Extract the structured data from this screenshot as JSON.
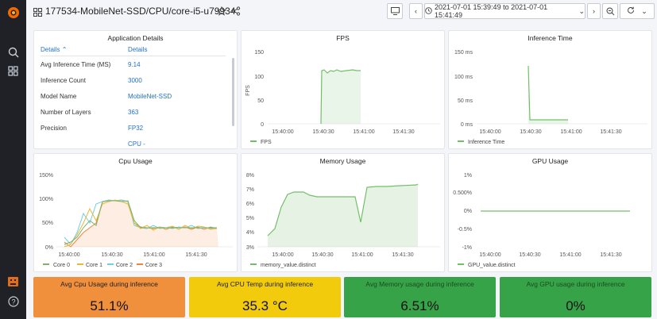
{
  "topbar": {
    "title": "177534-MobileNet-SSD/CPU/core-i5-u79934",
    "time_range": "2021-07-01 15:39:49 to 2021-07-01 15:41:49"
  },
  "app_details": {
    "title": "Application Details",
    "col1_header": "Details",
    "col2_header": "Details",
    "rows": [
      {
        "key": "Avg Inference Time (MS)",
        "value": "9.14"
      },
      {
        "key": "Inference Count",
        "value": "3000"
      },
      {
        "key": "Model Name",
        "value": "MobileNet-SSD"
      },
      {
        "key": "Number of Layers",
        "value": "363"
      },
      {
        "key": "Precision",
        "value": "FP32"
      },
      {
        "key": "",
        "value": "CPU -"
      }
    ]
  },
  "charts": {
    "fps": {
      "title": "FPS",
      "ylabel": "FPS",
      "yticks": [
        "150",
        "100",
        "50",
        "0"
      ],
      "xticks": [
        "15:40:00",
        "15:40:30",
        "15:41:00",
        "15:41:30"
      ],
      "legend": [
        "FPS"
      ]
    },
    "inference": {
      "title": "Inference Time",
      "yticks": [
        "150 ms",
        "100 ms",
        "50 ms",
        "0 ms"
      ],
      "xticks": [
        "15:40:00",
        "15:40:30",
        "15:41:00",
        "15:41:30"
      ],
      "legend": [
        "Inference Time"
      ]
    },
    "cpu": {
      "title": "Cpu Usage",
      "yticks": [
        "150%",
        "100%",
        "50%",
        "0%"
      ],
      "xticks": [
        "15:40:00",
        "15:40:30",
        "15:41:00",
        "15:41:30"
      ],
      "legend": [
        "Core 0",
        "Core 1",
        "Core 2",
        "Core 3"
      ]
    },
    "memory": {
      "title": "Memory Usage",
      "yticks": [
        "8%",
        "7%",
        "6%",
        "5%",
        "4%",
        "3%"
      ],
      "xticks": [
        "15:40:00",
        "15:40:30",
        "15:41:00",
        "15:41:30"
      ],
      "legend": [
        "memory_value.distinct"
      ]
    },
    "gpu": {
      "title": "GPU Usage",
      "yticks": [
        "1%",
        "0.500%",
        "0%",
        "-0.5%",
        "-1%"
      ],
      "xticks": [
        "15:40:00",
        "15:40:30",
        "15:41:00",
        "15:41:30"
      ],
      "legend": [
        "GPU_value.distinct"
      ]
    }
  },
  "chart_data": [
    {
      "type": "line",
      "title": "FPS",
      "ylabel": "FPS",
      "ylim": [
        0,
        150
      ],
      "x": [
        "15:40:28",
        "15:40:29",
        "15:40:31",
        "15:40:35",
        "15:40:40",
        "15:40:45",
        "15:40:50",
        "15:40:56"
      ],
      "series": [
        {
          "name": "FPS",
          "values": [
            0,
            112,
            108,
            110,
            111,
            109,
            111,
            110
          ]
        }
      ]
    },
    {
      "type": "line",
      "title": "Inference Time",
      "ylim": [
        0,
        150
      ],
      "x": [
        "15:40:30",
        "15:40:31",
        "15:40:33",
        "15:40:45",
        "15:40:58"
      ],
      "series": [
        {
          "name": "Inference Time",
          "values": [
            120,
            10,
            9,
            9,
            9
          ]
        }
      ]
    },
    {
      "type": "line",
      "title": "Cpu Usage",
      "ylim": [
        0,
        150
      ],
      "x": [
        "15:39:50",
        "15:39:56",
        "15:40:02",
        "15:40:08",
        "15:40:14",
        "15:40:20",
        "15:40:26",
        "15:40:32",
        "15:40:38",
        "15:40:44",
        "15:40:50",
        "15:40:56",
        "15:41:02",
        "15:41:08",
        "15:41:14",
        "15:41:20",
        "15:41:26",
        "15:41:32",
        "15:41:38"
      ],
      "series": [
        {
          "name": "Core 0",
          "values": [
            5,
            10,
            20,
            40,
            55,
            45,
            95,
            96,
            95,
            94,
            95,
            55,
            40,
            40,
            40,
            40,
            40,
            40,
            40
          ]
        },
        {
          "name": "Core 1",
          "values": [
            0,
            5,
            25,
            50,
            80,
            55,
            90,
            95,
            98,
            95,
            90,
            50,
            38,
            45,
            35,
            42,
            40,
            40,
            38
          ]
        },
        {
          "name": "Core 2",
          "values": [
            20,
            5,
            30,
            70,
            50,
            90,
            95,
            98,
            96,
            97,
            95,
            45,
            40,
            38,
            45,
            38,
            40,
            38,
            40
          ]
        },
        {
          "name": "Core 3",
          "values": [
            10,
            0,
            15,
            30,
            40,
            50,
            92,
            94,
            93,
            95,
            94,
            50,
            42,
            40,
            38,
            42,
            38,
            42,
            40
          ]
        }
      ]
    },
    {
      "type": "area",
      "title": "Memory Usage",
      "ylim": [
        3,
        8
      ],
      "x": [
        "15:39:55",
        "15:40:00",
        "15:40:05",
        "15:40:10",
        "15:40:15",
        "15:40:20",
        "15:40:25",
        "15:40:30",
        "15:40:35",
        "15:40:40",
        "15:40:45",
        "15:40:50",
        "15:40:55",
        "15:41:00",
        "15:41:05",
        "15:41:10",
        "15:41:20",
        "15:41:30",
        "15:41:40"
      ],
      "series": [
        {
          "name": "memory_value.distinct",
          "values": [
            3.5,
            4.0,
            5.5,
            6.7,
            6.75,
            6.7,
            6.5,
            6.5,
            6.5,
            6.5,
            6.55,
            6.5,
            4.7,
            7.1,
            7.2,
            7.2,
            7.25,
            7.3,
            7.4
          ]
        }
      ]
    },
    {
      "type": "line",
      "title": "GPU Usage",
      "ylim": [
        -1,
        1
      ],
      "x": [
        "15:39:50",
        "15:41:50"
      ],
      "series": [
        {
          "name": "GPU_value.distinct",
          "values": [
            0,
            0
          ]
        }
      ]
    }
  ],
  "stats": [
    {
      "title": "Avg Cpu Usage during inference",
      "value": "51.1%",
      "color": "#f0903d"
    },
    {
      "title": "Avg CPU Temp during inference",
      "value": "35.3 °C",
      "color": "#f2cc0c"
    },
    {
      "title": "Avg Memory usage during inference",
      "value": "6.51%",
      "color": "#37a348"
    },
    {
      "title": "Avg GPU usage during inference",
      "value": "0%",
      "color": "#37a348"
    }
  ],
  "colors": {
    "green": "#73bf69",
    "core0": "#7eb26d",
    "core1": "#eab839",
    "core2": "#6ed0e0",
    "core3": "#ef843c",
    "link": "#2273c7"
  }
}
